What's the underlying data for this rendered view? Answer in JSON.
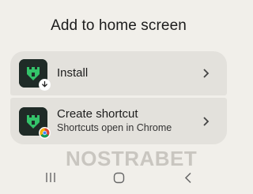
{
  "dialog": {
    "title": "Add to home screen",
    "options": [
      {
        "label": "Install",
        "badge_icon": "download-arrow-icon"
      },
      {
        "label": "Create shortcut",
        "sublabel": "Shortcuts open in Chrome",
        "badge_icon": "chrome-icon"
      }
    ]
  },
  "watermark": "NOSTRABET",
  "navbar": {
    "recents_icon": "recents-icon",
    "home_icon": "home-icon",
    "back_icon": "back-icon"
  },
  "colors": {
    "background": "#f1efea",
    "card": "#e3e1dc",
    "app_icon_bg": "#1f2b27",
    "app_icon_fg": "#34c36a"
  }
}
